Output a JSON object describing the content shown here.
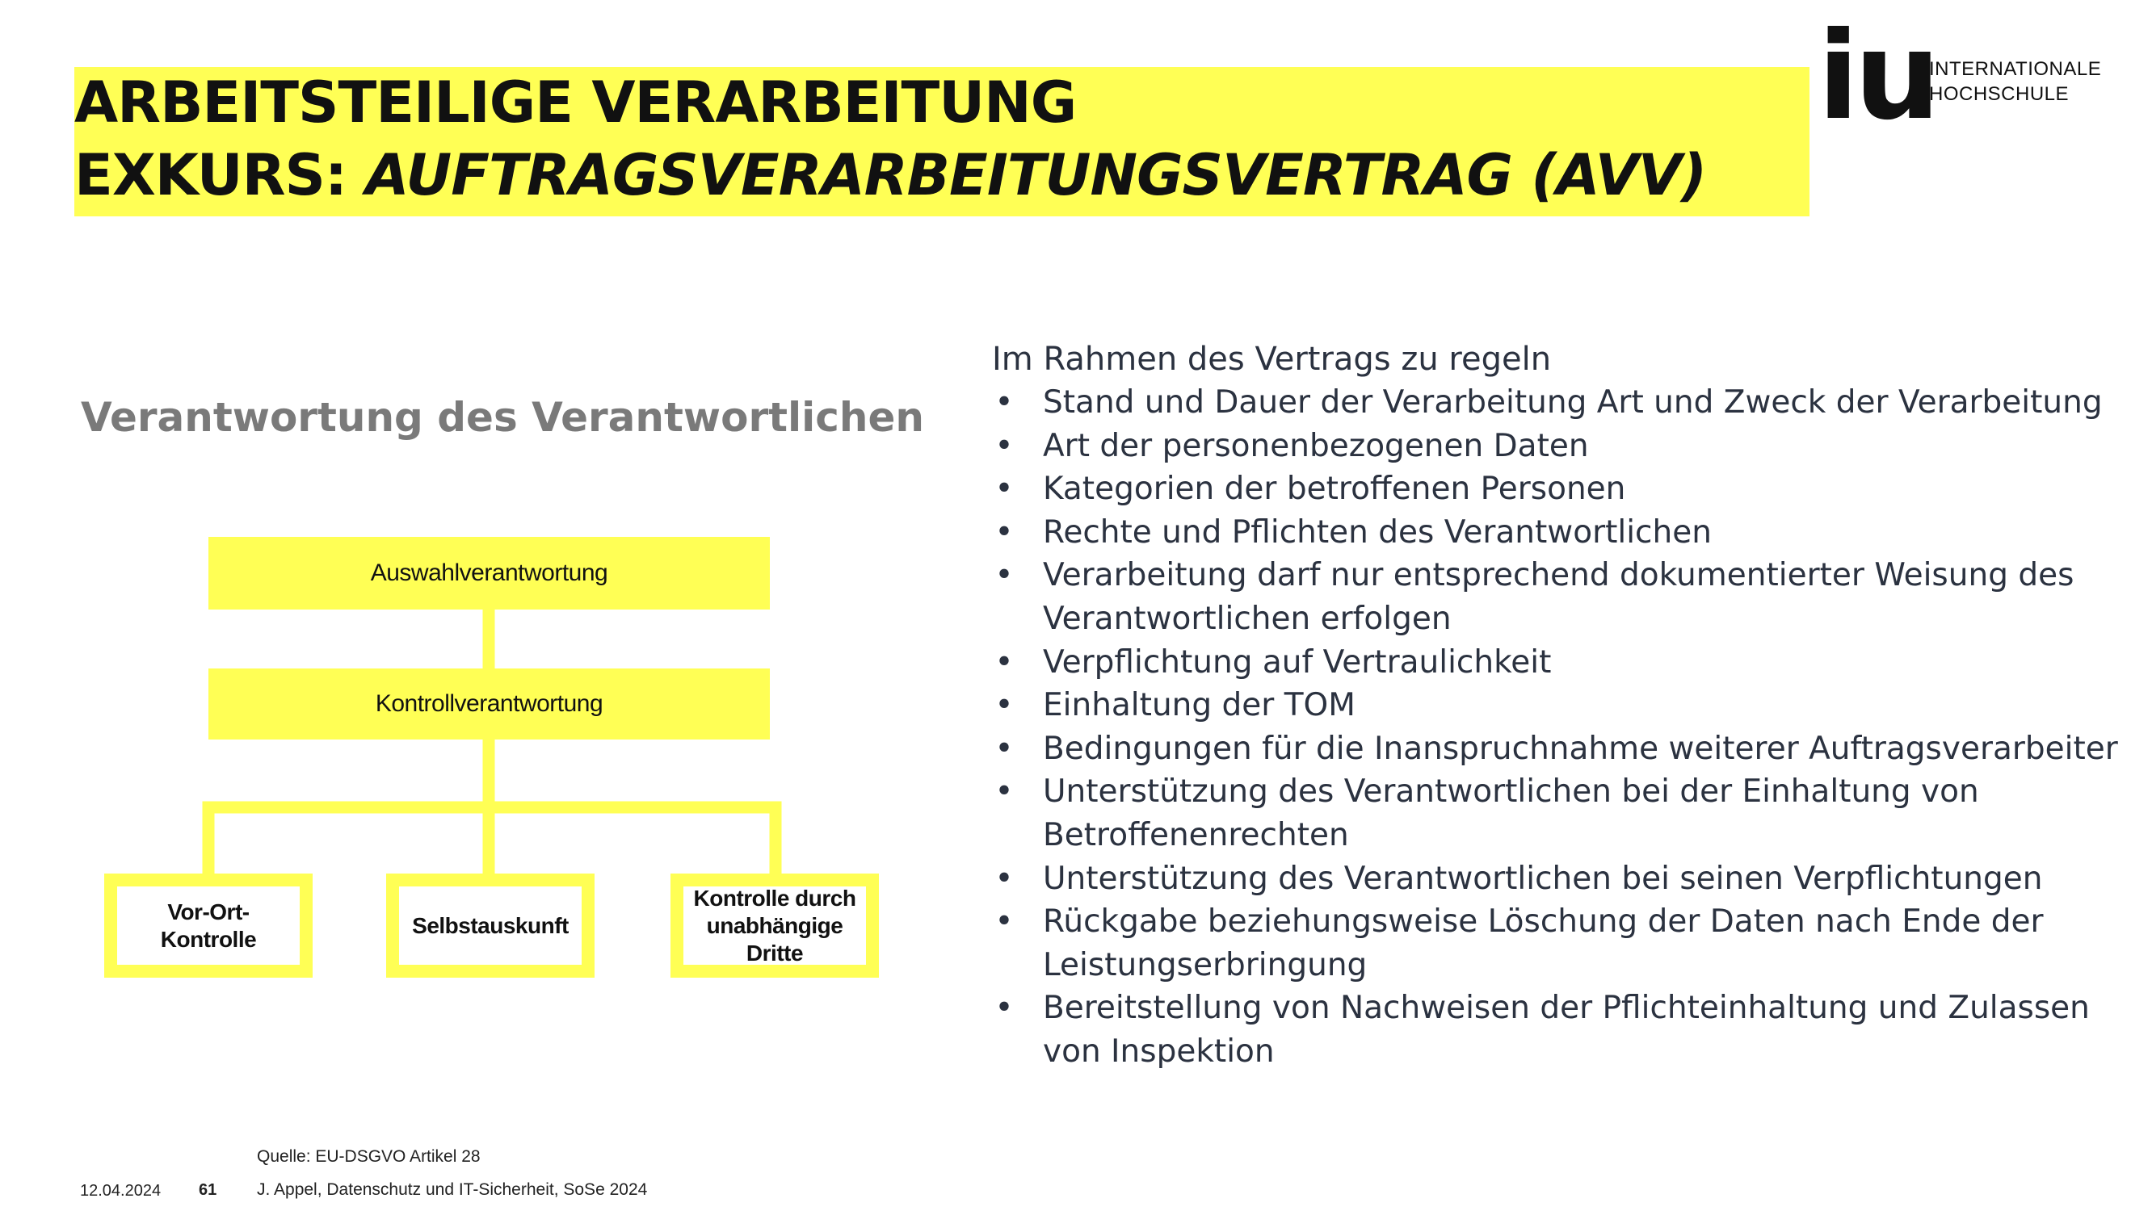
{
  "header": {
    "title_line1": "ARBEITSTEILIGE VERARBEITUNG",
    "title_line2_prefix": "EXKURS: ",
    "title_line2_italic": "AUFTRAGSVERARBEITUNGSVERTRAG (AVV)"
  },
  "logo": {
    "mark": "iu",
    "line1": "INTERNATIONALE",
    "line2": "HOCHSCHULE"
  },
  "diagram": {
    "title": "Verantwortung des Verantwortlichen",
    "top_node": "Auswahlverantwortung",
    "middle_node": "Kontrollverantwortung",
    "children": [
      "Vor-Ort-\nKontrolle",
      "Selbstauskunft",
      "Kontrolle durch\nunabhängige\nDritte"
    ]
  },
  "content": {
    "intro": "Im Rahmen des Vertrags zu regeln",
    "bullet_symbol": "•",
    "bullets": [
      "Stand und Dauer der Verarbeitung Art und Zweck der Verarbeitung",
      "Art der personenbezogenen Daten",
      "Kategorien der betroffenen Personen",
      "Rechte und Pflichten des Verantwortlichen",
      "Verarbeitung darf nur entsprechend dokumentierter Weisung des Verantwortlichen erfolgen",
      "Verpflichtung auf Vertraulichkeit",
      "Einhaltung der TOM",
      "Bedingungen für die Inanspruchnahme weiterer Auftragsverarbeiter",
      "Unterstützung des Verantwortlichen bei der Einhaltung von Betroffenenrechten",
      "Unterstützung des Verantwortlichen bei seinen Verpflichtungen",
      "Rückgabe beziehungsweise Löschung der Daten nach Ende der Leistungserbringung",
      "Bereitstellung von Nachweisen der Pflichteinhaltung und Zulassen von Inspektion"
    ]
  },
  "footer": {
    "source": "Quelle: EU-DSGVO Artikel 28",
    "date": "12.04.2024",
    "page": "61",
    "author": "J. Appel, Datenschutz und IT-Sicherheit, SoSe 2024"
  },
  "colors": {
    "accent_yellow": "#ffff55",
    "text_dark": "#2b3240"
  }
}
